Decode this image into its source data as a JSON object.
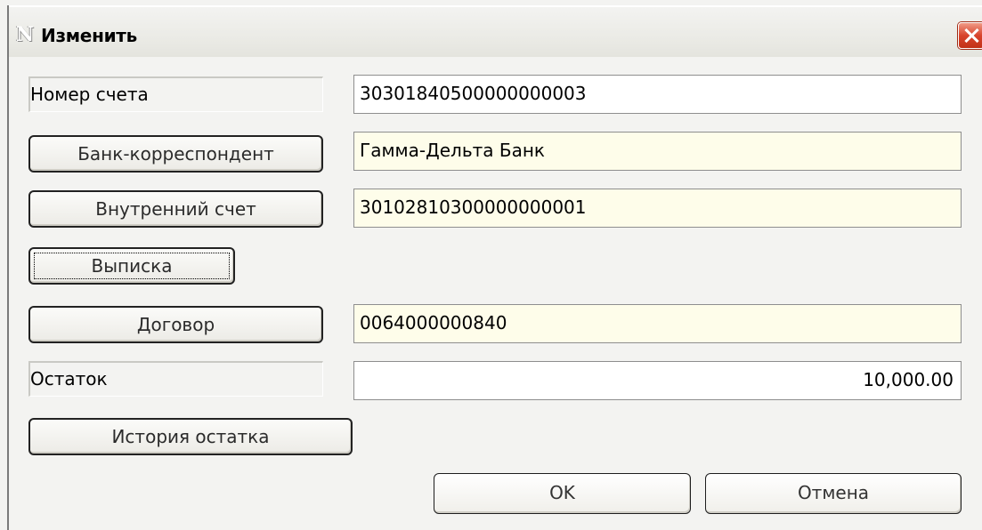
{
  "window": {
    "title": "Изменить",
    "icon": "app-n-icon"
  },
  "rows": {
    "account_number_label": "Номер счета",
    "account_number_value": "30301840500000000003",
    "correspondent_bank_button": "Банк-корреспондент",
    "correspondent_bank_value": "Гамма-Дельта Банк",
    "internal_account_button": "Внутренний счет",
    "internal_account_value": "30102810300000000001",
    "statement_button": "Выписка",
    "contract_button": "Договор",
    "contract_value": "0064000000840",
    "balance_label": "Остаток",
    "balance_value": "10,000.00",
    "balance_history_button": "История остатка"
  },
  "footer": {
    "ok_label": "OK",
    "cancel_label": "Отмена"
  },
  "colors": {
    "field_white": "#ffffff",
    "field_yellow": "#fefdea",
    "close_red": "#d8442c"
  }
}
